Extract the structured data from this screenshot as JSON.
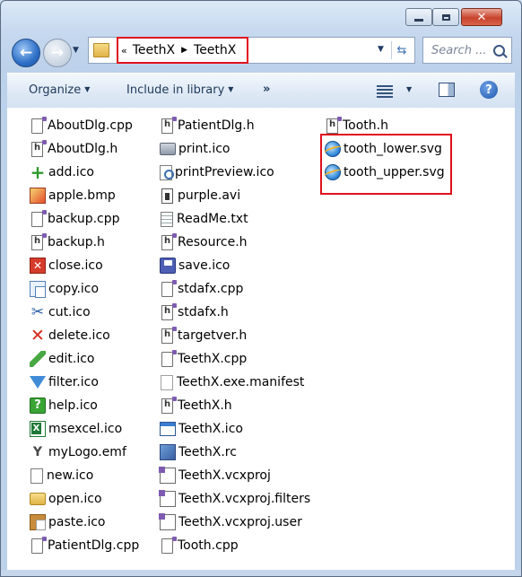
{
  "address_bar": {
    "overflow_glyph": "«",
    "crumbs": [
      "TeethX",
      "TeethX"
    ],
    "separator": "▶"
  },
  "search": {
    "placeholder": "Search ..."
  },
  "toolbar": {
    "organize": "Organize",
    "include_in_library": "Include in library",
    "more": "»"
  },
  "files": {
    "column1": [
      {
        "name": "AboutDlg.cpp",
        "icon": "cpp-file-icon"
      },
      {
        "name": "AboutDlg.h",
        "icon": "header-file-icon"
      },
      {
        "name": "add.ico",
        "icon": "add-icon"
      },
      {
        "name": "apple.bmp",
        "icon": "bitmap-icon"
      },
      {
        "name": "backup.cpp",
        "icon": "cpp-file-icon"
      },
      {
        "name": "backup.h",
        "icon": "header-file-icon"
      },
      {
        "name": "close.ico",
        "icon": "close-icon"
      },
      {
        "name": "copy.ico",
        "icon": "copy-icon"
      },
      {
        "name": "cut.ico",
        "icon": "scissors-icon"
      },
      {
        "name": "delete.ico",
        "icon": "delete-icon"
      },
      {
        "name": "edit.ico",
        "icon": "pencil-icon"
      },
      {
        "name": "filter.ico",
        "icon": "filter-icon"
      },
      {
        "name": "help.ico",
        "icon": "help-icon"
      },
      {
        "name": "msexcel.ico",
        "icon": "excel-icon"
      },
      {
        "name": "myLogo.emf",
        "icon": "logo-icon"
      },
      {
        "name": "new.ico",
        "icon": "new-file-icon"
      },
      {
        "name": "open.ico",
        "icon": "open-folder-icon"
      },
      {
        "name": "paste.ico",
        "icon": "paste-icon"
      },
      {
        "name": "PatientDlg.cpp",
        "icon": "cpp-file-icon"
      }
    ],
    "column2": [
      {
        "name": "PatientDlg.h",
        "icon": "header-file-icon"
      },
      {
        "name": "print.ico",
        "icon": "printer-icon"
      },
      {
        "name": "printPreview.ico",
        "icon": "print-preview-icon"
      },
      {
        "name": "purple.avi",
        "icon": "video-file-icon"
      },
      {
        "name": "ReadMe.txt",
        "icon": "text-file-icon"
      },
      {
        "name": "Resource.h",
        "icon": "header-file-icon"
      },
      {
        "name": "save.ico",
        "icon": "floppy-disk-icon"
      },
      {
        "name": "stdafx.cpp",
        "icon": "cpp-file-icon"
      },
      {
        "name": "stdafx.h",
        "icon": "header-file-icon"
      },
      {
        "name": "targetver.h",
        "icon": "header-file-icon"
      },
      {
        "name": "TeethX.cpp",
        "icon": "cpp-file-icon"
      },
      {
        "name": "TeethX.exe.manifest",
        "icon": "manifest-file-icon"
      },
      {
        "name": "TeethX.h",
        "icon": "header-file-icon"
      },
      {
        "name": "TeethX.ico",
        "icon": "window-icon"
      },
      {
        "name": "TeethX.rc",
        "icon": "resource-script-icon"
      },
      {
        "name": "TeethX.vcxproj",
        "icon": "vc-project-icon"
      },
      {
        "name": "TeethX.vcxproj.filters",
        "icon": "vc-filters-icon"
      },
      {
        "name": "TeethX.vcxproj.user",
        "icon": "vc-user-icon"
      },
      {
        "name": "Tooth.cpp",
        "icon": "cpp-file-icon"
      }
    ],
    "column3": [
      {
        "name": "Tooth.h",
        "icon": "header-file-icon"
      },
      {
        "name": "tooth_lower.svg",
        "icon": "svg-file-icon"
      },
      {
        "name": "tooth_upper.svg",
        "icon": "svg-file-icon"
      }
    ]
  },
  "colors": {
    "highlight_box": "#e0101b",
    "toolbar_text": "#1e395b",
    "window_frame": "#c4d7ee"
  }
}
